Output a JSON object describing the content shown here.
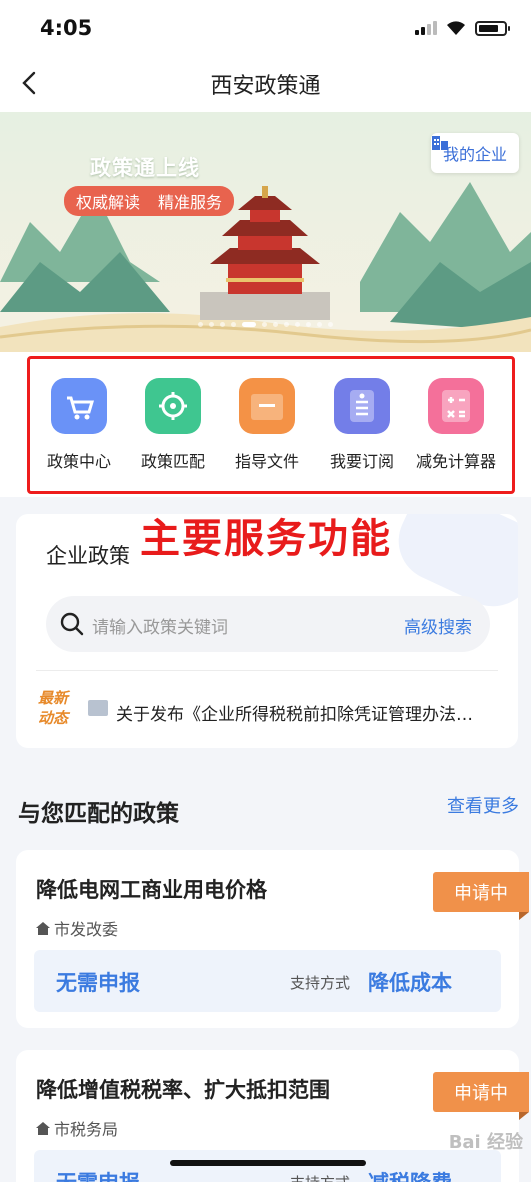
{
  "status_bar": {
    "time": "4:05"
  },
  "nav": {
    "title": "西安政策通"
  },
  "banner": {
    "title": "政策通上线",
    "tags": [
      "权威解读",
      "精准服务"
    ],
    "enterprise_button": "我的企业"
  },
  "services": [
    {
      "label": "政策中心",
      "icon": "cart-icon",
      "color": "#5c86f5"
    },
    {
      "label": "政策匹配",
      "icon": "target-icon",
      "color": "#37c48a"
    },
    {
      "label": "指导文件",
      "icon": "folder-icon",
      "color": "#f28a42"
    },
    {
      "label": "我要订阅",
      "icon": "subscribe-icon",
      "color": "#6d78e6"
    },
    {
      "label": "减免计算器",
      "icon": "calculator-icon",
      "color": "#f2668d"
    }
  ],
  "annotation": "主要服务功能",
  "enterprise_policy": {
    "title": "企业政策",
    "search_placeholder": "请输入政策关键词",
    "advanced_search": "高级搜索",
    "latest_label": "最新动态",
    "news": "关于发布《企业所得税税前扣除凭证管理办法…"
  },
  "matched": {
    "title": "与您匹配的政策",
    "more": "查看更多",
    "items": [
      {
        "title": "降低电网工商业用电价格",
        "department": "市发改委",
        "badge": "申请中",
        "left": "无需申报",
        "support_label": "支持方式",
        "right": "降低成本"
      },
      {
        "title": "降低增值税税率、扩大抵扣范围",
        "department": "市税务局",
        "badge": "申请中",
        "left": "无需申报",
        "support_label": "支持方式",
        "right": "减税降费"
      }
    ]
  },
  "watermark": "Bai 经验"
}
